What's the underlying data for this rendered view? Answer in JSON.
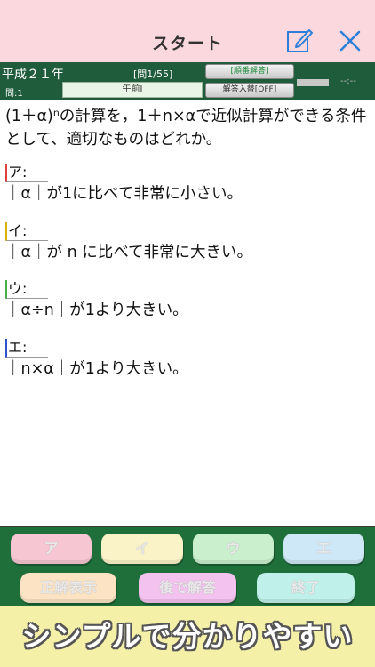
{
  "nav": {
    "title": "スタート",
    "edit_icon": "edit-note-icon",
    "close_icon": "close-icon"
  },
  "header": {
    "year": "平成２１年",
    "question_no": "問:1",
    "counter": "[問1/55]",
    "session": "午前Ⅰ",
    "order_button": "[順番解答]",
    "answer_toggle_button": "解答入替[OFF]",
    "timer": "--:--"
  },
  "question": {
    "text": "(1＋α)ⁿの計算を，1＋n×αで近似計算ができる条件として、適切なものはどれか。",
    "options": [
      {
        "mark": "ア:",
        "text": "｜α｜が1に比べて非常に小さい。"
      },
      {
        "mark": "イ:",
        "text": "｜α｜が n に比べて非常に大きい。"
      },
      {
        "mark": "ウ:",
        "text": "｜α÷n｜が1より大きい。"
      },
      {
        "mark": "エ:",
        "text": "｜n×α｜が1より大きい。"
      }
    ]
  },
  "buttons": {
    "a": "ア",
    "i": "イ",
    "u": "ウ",
    "e": "エ",
    "show_answer": "正解表示",
    "answer_later": "後で解答",
    "end": "終了"
  },
  "colors": {
    "nav_bg": "#fbd8dd",
    "header_bg": "#1f5c3b",
    "panel_bg": "#1f6f3a",
    "tagline_bg": "#f5f0a8"
  },
  "tagline": "シンプルで分かりやすい"
}
